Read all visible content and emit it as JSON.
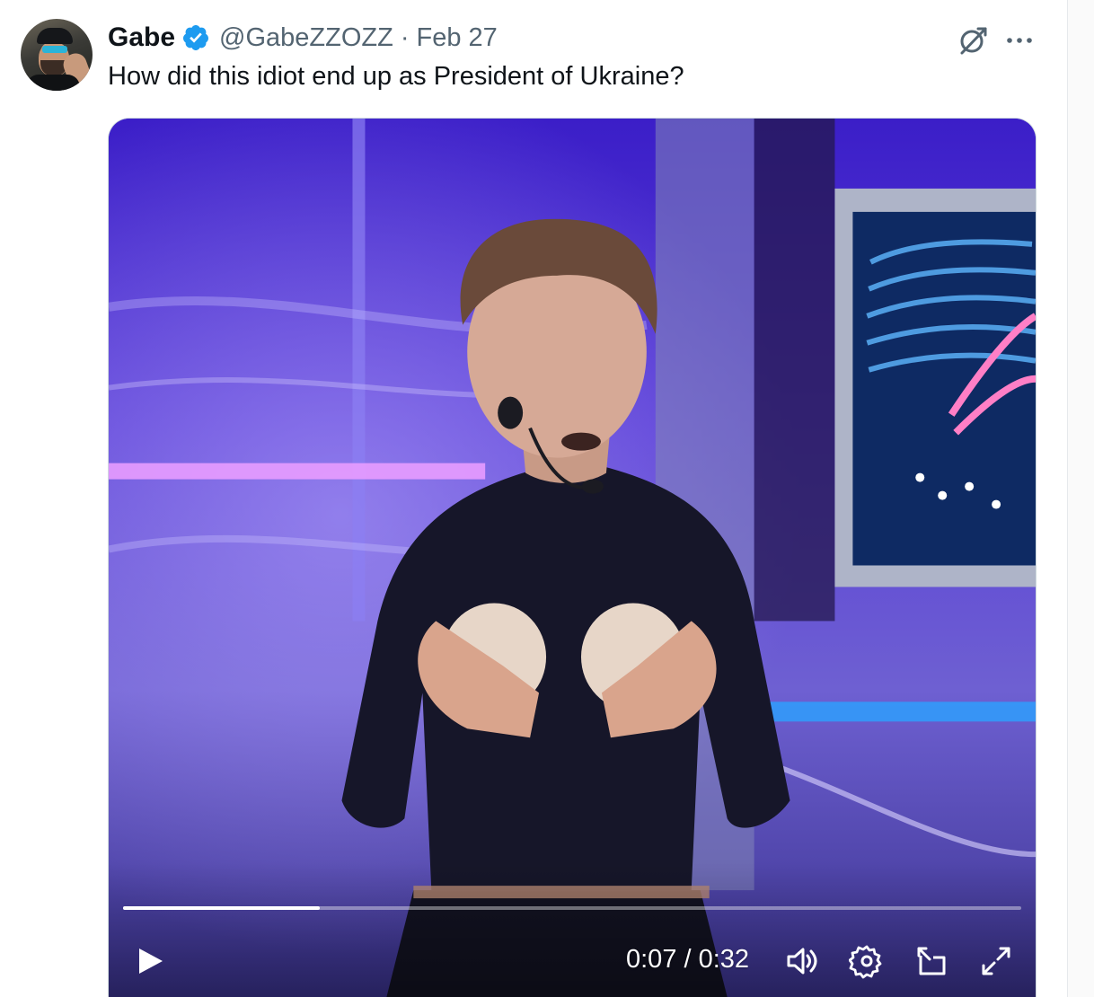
{
  "tweet": {
    "author": {
      "display_name": "Gabe",
      "handle": "@GabeZZOZZ",
      "verified": true
    },
    "separator": "·",
    "date": "Feb 27",
    "text": "How did this idiot end up as President of Ukraine?",
    "actions": {
      "grok_icon": "grok-icon",
      "more_icon": "more-icon"
    }
  },
  "video": {
    "current_time": "0:07",
    "duration": "0:32",
    "time_label": "0:07 / 0:32",
    "progress_fraction": 0.21875,
    "controls": {
      "play": "play-icon",
      "volume": "volume-icon",
      "settings": "gear-icon",
      "pip": "picture-in-picture-icon",
      "fullscreen": "fullscreen-icon"
    }
  },
  "colors": {
    "verified_badge": "#1d9bf0",
    "secondary_text": "#536471",
    "primary_text": "#0f1419"
  }
}
